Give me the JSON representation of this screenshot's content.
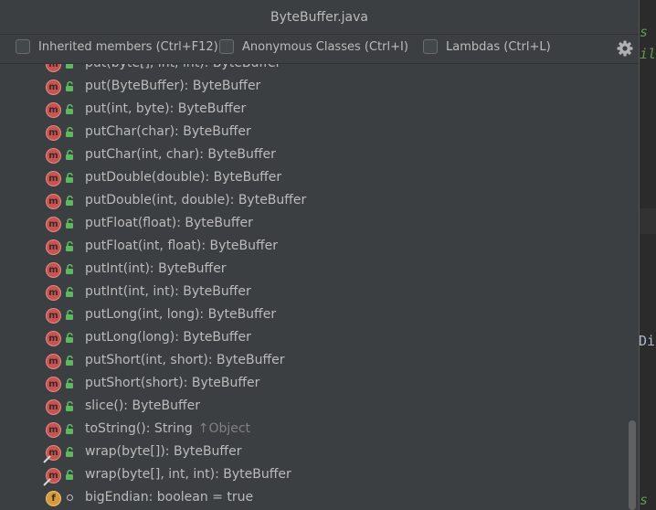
{
  "window": {
    "title": "ByteBuffer.java"
  },
  "options": {
    "inherited_members": "Inherited members (Ctrl+F12)",
    "anonymous_classes": "Anonymous Classes (Ctrl+I)",
    "lambdas": "Lambdas (Ctrl+L)",
    "settings_icon": "gear-icon"
  },
  "editor_fragments": {
    "frag1": "s",
    "frag2": "il",
    "frag3": "Di",
    "frag4": "s"
  },
  "members": [
    {
      "kind": "method",
      "static": false,
      "visibility": "public",
      "signature": "put(byte[], int, int): ByteBuffer",
      "inherited": ""
    },
    {
      "kind": "method",
      "static": false,
      "visibility": "public",
      "signature": "put(ByteBuffer): ByteBuffer",
      "inherited": ""
    },
    {
      "kind": "method",
      "static": false,
      "visibility": "public",
      "signature": "put(int, byte): ByteBuffer",
      "inherited": ""
    },
    {
      "kind": "method",
      "static": false,
      "visibility": "public",
      "signature": "putChar(char): ByteBuffer",
      "inherited": ""
    },
    {
      "kind": "method",
      "static": false,
      "visibility": "public",
      "signature": "putChar(int, char): ByteBuffer",
      "inherited": ""
    },
    {
      "kind": "method",
      "static": false,
      "visibility": "public",
      "signature": "putDouble(double): ByteBuffer",
      "inherited": ""
    },
    {
      "kind": "method",
      "static": false,
      "visibility": "public",
      "signature": "putDouble(int, double): ByteBuffer",
      "inherited": ""
    },
    {
      "kind": "method",
      "static": false,
      "visibility": "public",
      "signature": "putFloat(float): ByteBuffer",
      "inherited": ""
    },
    {
      "kind": "method",
      "static": false,
      "visibility": "public",
      "signature": "putFloat(int, float): ByteBuffer",
      "inherited": ""
    },
    {
      "kind": "method",
      "static": false,
      "visibility": "public",
      "signature": "putInt(int): ByteBuffer",
      "inherited": ""
    },
    {
      "kind": "method",
      "static": false,
      "visibility": "public",
      "signature": "putInt(int, int): ByteBuffer",
      "inherited": ""
    },
    {
      "kind": "method",
      "static": false,
      "visibility": "public",
      "signature": "putLong(int, long): ByteBuffer",
      "inherited": ""
    },
    {
      "kind": "method",
      "static": false,
      "visibility": "public",
      "signature": "putLong(long): ByteBuffer",
      "inherited": ""
    },
    {
      "kind": "method",
      "static": false,
      "visibility": "public",
      "signature": "putShort(int, short): ByteBuffer",
      "inherited": ""
    },
    {
      "kind": "method",
      "static": false,
      "visibility": "public",
      "signature": "putShort(short): ByteBuffer",
      "inherited": ""
    },
    {
      "kind": "method",
      "static": false,
      "visibility": "public",
      "signature": "slice(): ByteBuffer",
      "inherited": ""
    },
    {
      "kind": "method",
      "static": false,
      "visibility": "public",
      "signature": "toString(): String",
      "inherited": "↑Object"
    },
    {
      "kind": "method",
      "static": true,
      "visibility": "public",
      "signature": "wrap(byte[]): ByteBuffer",
      "inherited": ""
    },
    {
      "kind": "method",
      "static": true,
      "visibility": "public",
      "signature": "wrap(byte[], int, int): ByteBuffer",
      "inherited": ""
    },
    {
      "kind": "field",
      "static": false,
      "visibility": "package",
      "signature": "bigEndian: boolean = true",
      "inherited": ""
    }
  ],
  "colors": {
    "method_icon": "#c75450",
    "field_icon": "#d49a3e",
    "public_lock": "#5fb85f",
    "text": "#bbbbbb",
    "inherited_text": "#808080"
  }
}
